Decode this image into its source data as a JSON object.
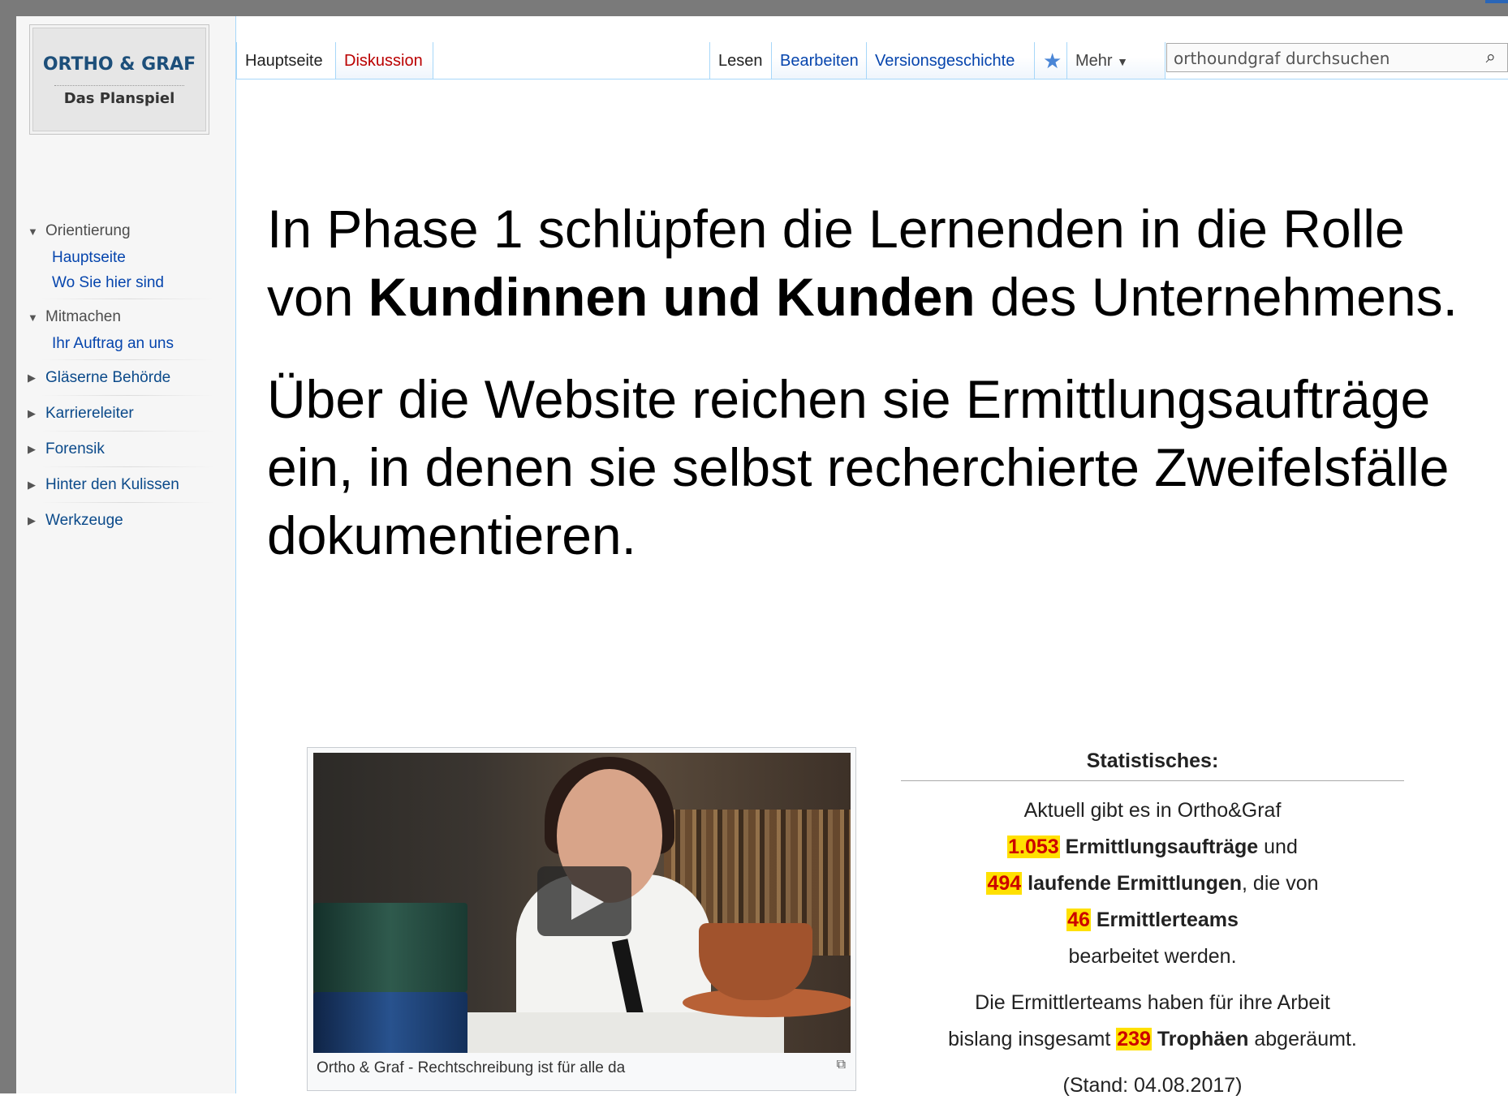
{
  "logo": {
    "title": "ORTHO & GRAF",
    "subtitle": "Das Planspiel"
  },
  "sidebar": {
    "groups": [
      {
        "label": "Orientierung",
        "expanded": true,
        "items": [
          "Hauptseite",
          "Wo Sie hier sind"
        ]
      },
      {
        "label": "Mitmachen",
        "expanded": true,
        "items": [
          "Ihr Auftrag an uns"
        ]
      },
      {
        "label": "Gläserne Behörde",
        "expanded": false
      },
      {
        "label": "Karriereleiter",
        "expanded": false
      },
      {
        "label": "Forensik",
        "expanded": false
      },
      {
        "label": "Hinter den Kulissen",
        "expanded": false
      },
      {
        "label": "Werkzeuge",
        "expanded": false
      }
    ]
  },
  "tabs": {
    "left": [
      "Hauptseite",
      "Diskussion"
    ],
    "right": [
      "Lesen",
      "Bearbeiten",
      "Versionsgeschichte"
    ],
    "more": "Mehr"
  },
  "search": {
    "placeholder": "orthoundgraf durchsuchen"
  },
  "main": {
    "p1_a": "In Phase 1 schlüpfen die Lernenden in die Rolle",
    "p1_b_pre": "von ",
    "p1_b_bold": "Kundinnen und Kunden",
    "p1_b_post": " des Unternehmens.",
    "p2_l1": "Über die Website reichen sie Ermittlungsaufträge",
    "p2_l2": "ein, in denen sie selbst recherchierte Zweifelsfälle",
    "p2_l3": "dokumentieren."
  },
  "video": {
    "caption": "Ortho & Graf - Rechtschreibung ist für alle da"
  },
  "stats": {
    "title": "Statistisches:",
    "line1": "Aktuell gibt es in Ortho&Graf",
    "orders_count": "1.053",
    "orders_label": "Ermittlungsaufträge",
    "orders_suffix": " und",
    "running_count": "494",
    "running_label": "laufende Ermittlungen",
    "running_suffix": ", die von",
    "teams_count": "46",
    "teams_label": "Ermittlerteams",
    "line5": "bearbeitet werden.",
    "line6": "Die Ermittlerteams haben für ihre Arbeit",
    "line7_pre": "bislang insgesamt ",
    "trophies_count": "239",
    "trophies_label": "Trophäen",
    "line7_post": " abgeräumt.",
    "stand": "(Stand: 04.08.2017)"
  },
  "colors": {
    "link": "#0645ad",
    "red_link": "#ba0000",
    "highlight": "#ffe000",
    "border": "#a7d7f9"
  }
}
